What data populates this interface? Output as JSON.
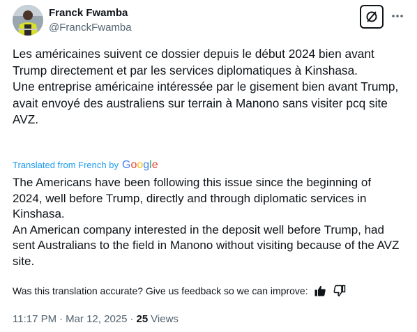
{
  "author": {
    "display_name": "Franck Fwamba",
    "handle": "@FranckFwamba"
  },
  "icons": {
    "grok": "grok-icon",
    "more": "more-dots-icon",
    "thumbs_up": "thumbs-up-icon",
    "thumbs_down": "thumbs-down-icon"
  },
  "original_text": [
    "Les américaines suivent ce dossier depuis le début 2024 bien avant Trump directement et par les services diplomatiques à Kinshasa.",
    "Une entreprise américaine intéressée par le gisement bien avant Trump, avait envoyé des australiens sur terrain à Manono sans visiter pcq site AVZ."
  ],
  "translation": {
    "label": "Translated from French by",
    "provider": "Google",
    "lines": [
      "The Americans have been following this issue since the beginning of 2024, well before Trump, directly and through diplomatic services in Kinshasa.",
      "An American company interested in the deposit well before Trump, had sent Australians to the field in Manono without visiting because of the AVZ site."
    ]
  },
  "feedback": {
    "prompt": "Was this translation accurate? Give us feedback so we can improve:"
  },
  "meta": {
    "time": "11:17 PM",
    "separator": "·",
    "date": "Mar 12, 2025",
    "views_count": "25",
    "views_label": "Views"
  },
  "colors": {
    "text": "#0f1419",
    "secondary": "#536471",
    "link": "#1d9bf0"
  }
}
